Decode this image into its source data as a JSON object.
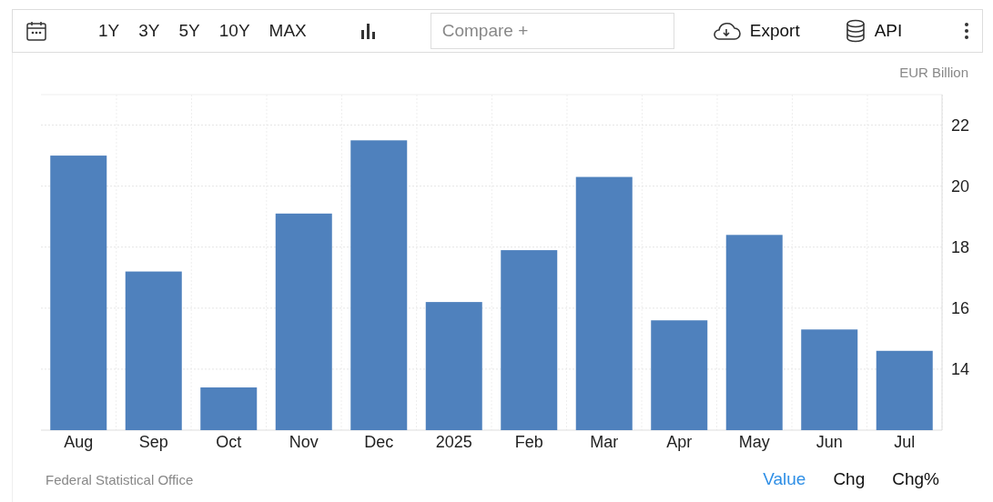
{
  "toolbar": {
    "ranges": [
      {
        "label": "1Y"
      },
      {
        "label": "3Y"
      },
      {
        "label": "5Y"
      },
      {
        "label": "10Y"
      },
      {
        "label": "MAX"
      }
    ],
    "compare": {
      "placeholder": "Compare +"
    },
    "export": {
      "label": "Export"
    },
    "api": {
      "label": "API"
    }
  },
  "chart": {
    "chart_data": {
      "type": "bar",
      "ylabel": "EUR Billion",
      "categories": [
        "Aug",
        "Sep",
        "Oct",
        "Nov",
        "Dec",
        "2025",
        "Feb",
        "Mar",
        "Apr",
        "May",
        "Jun",
        "Jul"
      ],
      "grid": true,
      "series": [
        {
          "color": "#4f81bd",
          "values": [
            21.0,
            17.2,
            13.4,
            19.1,
            21.5,
            16.2,
            17.9,
            20.3,
            15.6,
            18.4,
            15.3,
            14.6
          ]
        }
      ],
      "ylim": [
        12,
        23
      ],
      "yticks": [
        14,
        16,
        18,
        20,
        22
      ]
    }
  },
  "footer": {
    "source": "Federal Statistical Office",
    "views": [
      {
        "label": "Value",
        "selected": true
      },
      {
        "label": "Chg",
        "selected": false
      },
      {
        "label": "Chg%",
        "selected": false
      }
    ]
  }
}
